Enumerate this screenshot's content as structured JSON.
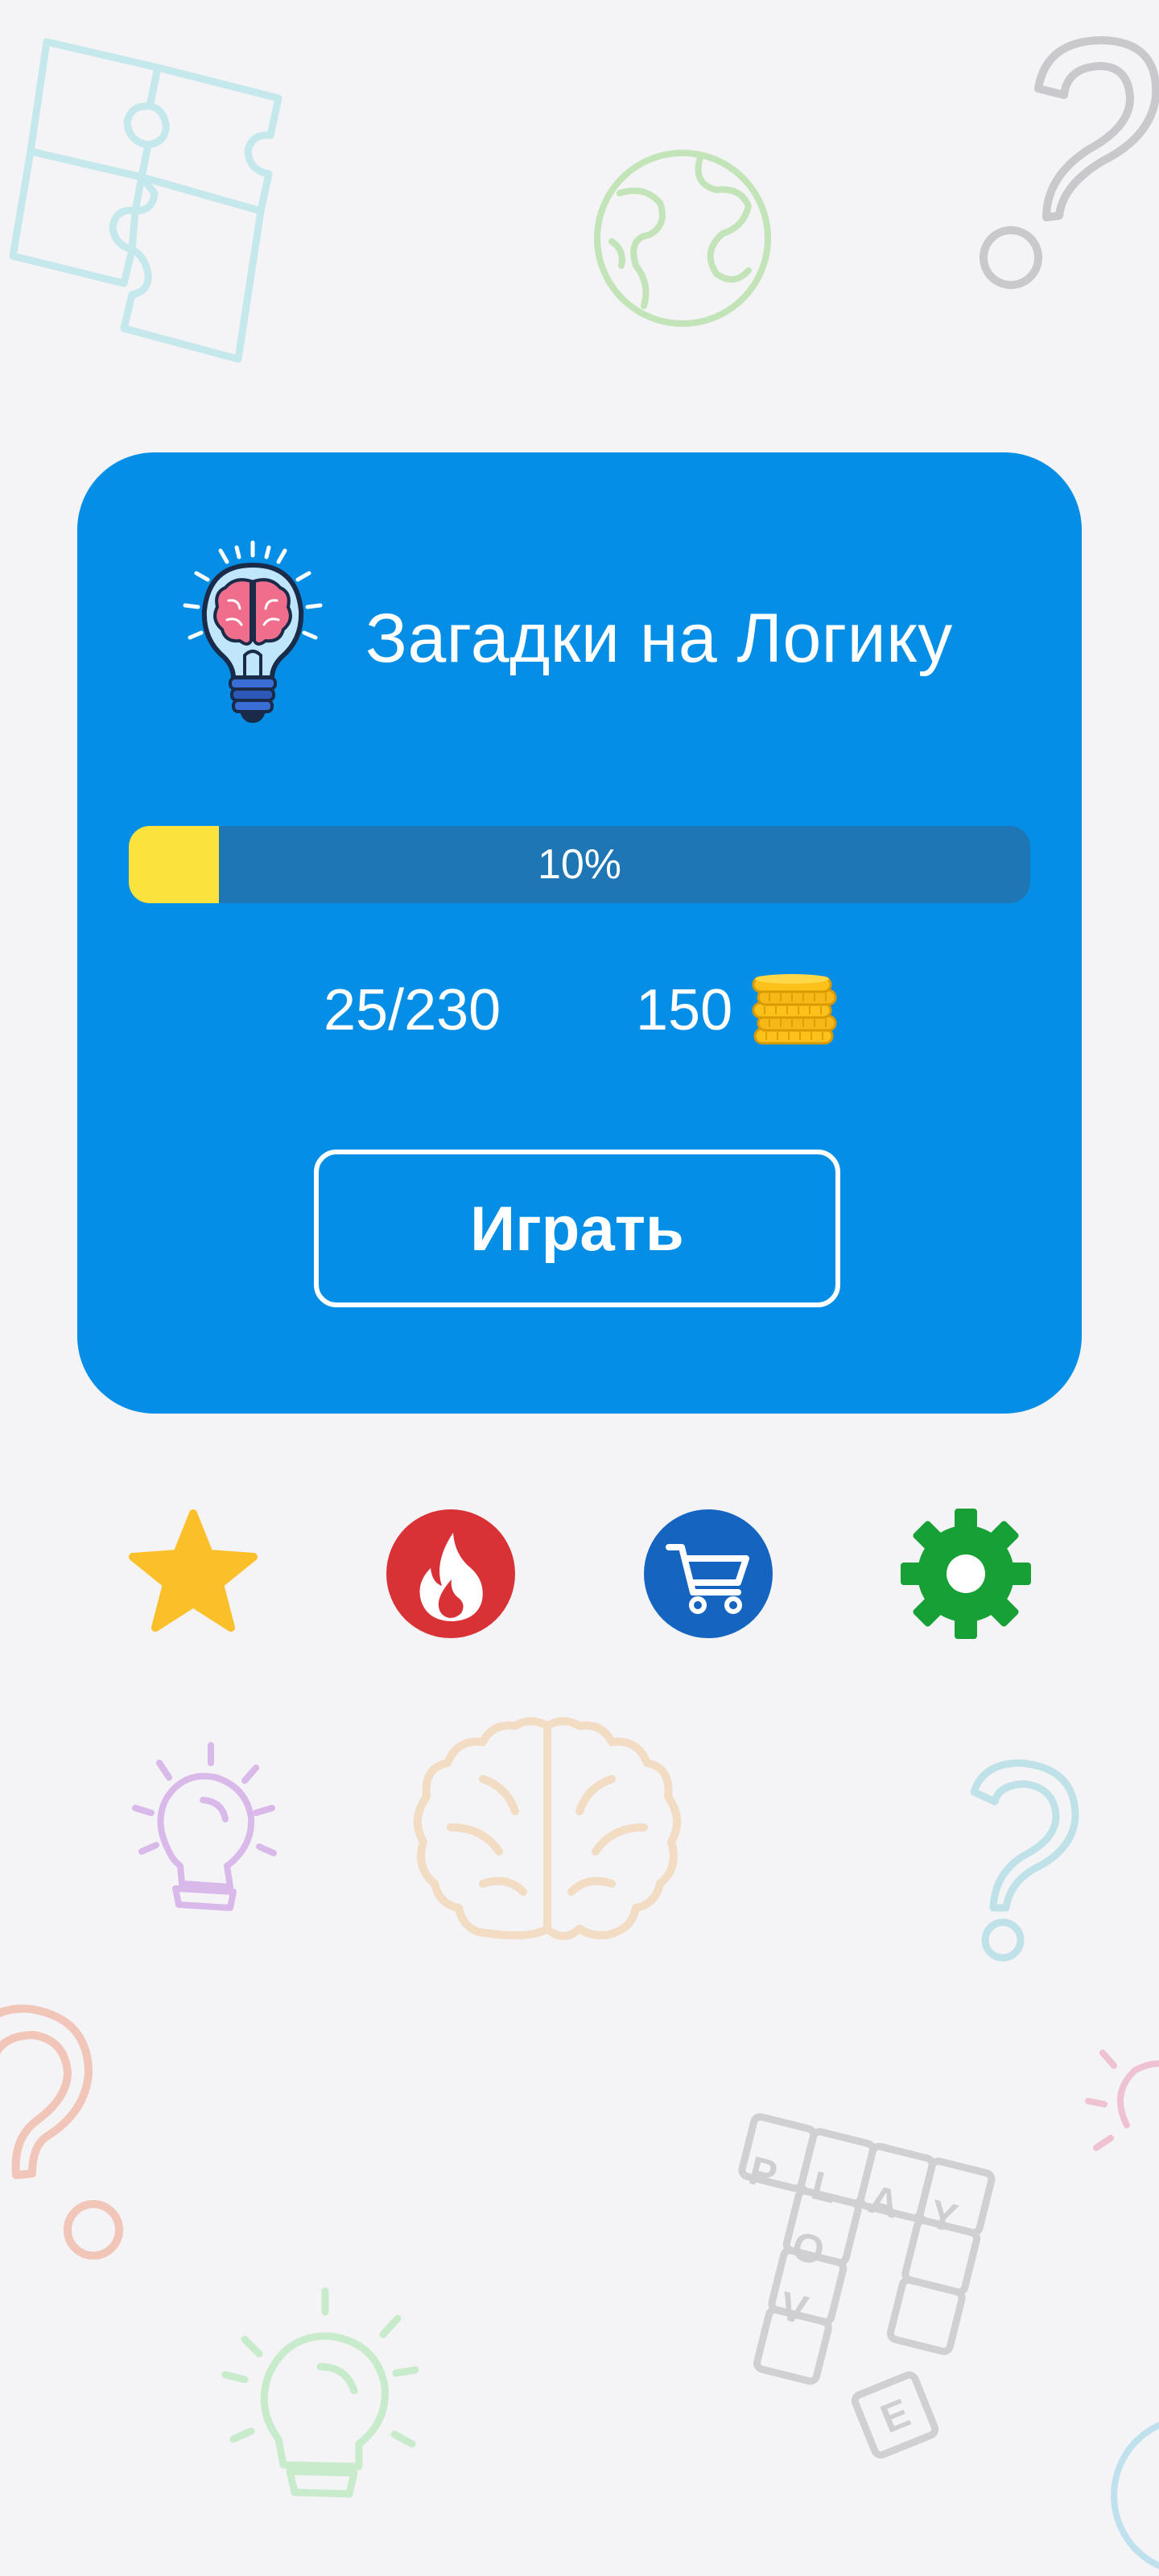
{
  "header": {
    "title": "Загадки на Логику",
    "logo_icon": "lightbulb-brain-icon"
  },
  "progress": {
    "percent": 10,
    "label": "10%",
    "fill_color": "#fbe23c",
    "track_color": "#1e76b4"
  },
  "stats": {
    "levels": "25/230",
    "coins": "150",
    "coins_icon": "coin-stack-icon"
  },
  "play_button": {
    "label": "Играть"
  },
  "nav": [
    {
      "name": "favorites",
      "icon": "star-icon",
      "color": "#fbbf2a"
    },
    {
      "name": "popular",
      "icon": "fire-icon",
      "color": "#d93236"
    },
    {
      "name": "shop",
      "icon": "cart-icon",
      "color": "#1565c0"
    },
    {
      "name": "settings",
      "icon": "gear-icon",
      "color": "#16a036"
    }
  ],
  "theme": {
    "background": "#f4f3f6",
    "card": "#058ee6"
  },
  "background_doodles": {
    "crossword_letters": [
      "P",
      "L",
      "A",
      "Y",
      "O",
      "V",
      "E"
    ]
  }
}
